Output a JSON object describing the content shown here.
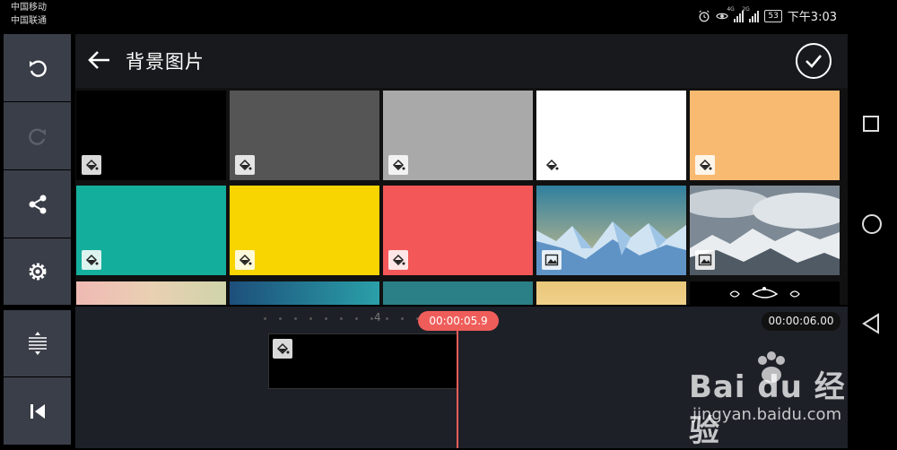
{
  "status_bar": {
    "carrier_1": "中国移动",
    "carrier_2": "中国联通",
    "signal_1_label": "4G",
    "signal_2_label": "2G",
    "battery": "53",
    "time": "下午3:03"
  },
  "toolbar": {
    "items": [
      "undo-icon",
      "redo-icon",
      "share-icon",
      "settings-icon",
      "split-icon",
      "skip-to-start-icon"
    ]
  },
  "header": {
    "title": "背景图片"
  },
  "grid": {
    "tiles": [
      {
        "kind": "color",
        "color": "#000000",
        "icon": "paint-bucket-icon"
      },
      {
        "kind": "color",
        "color": "#555555",
        "icon": "paint-bucket-icon"
      },
      {
        "kind": "color",
        "color": "#a9a9a9",
        "icon": "paint-bucket-icon"
      },
      {
        "kind": "color",
        "color": "#ffffff",
        "icon": "paint-bucket-icon"
      },
      {
        "kind": "color",
        "color": "#f8ba70",
        "icon": "paint-bucket-icon"
      },
      {
        "kind": "color",
        "color": "#14ae9c",
        "icon": "paint-bucket-icon"
      },
      {
        "kind": "color",
        "color": "#f8d400",
        "icon": "paint-bucket-icon"
      },
      {
        "kind": "color",
        "color": "#f35757",
        "icon": "paint-bucket-icon"
      },
      {
        "kind": "image",
        "subject": "low-poly mountains",
        "icon": "image-icon"
      },
      {
        "kind": "image",
        "subject": "snowy mountains under clouds",
        "icon": "image-icon"
      },
      {
        "kind": "image",
        "subject": "pink bokeh"
      },
      {
        "kind": "image",
        "subject": "teal gradient"
      },
      {
        "kind": "image",
        "subject": "dark teal"
      },
      {
        "kind": "image",
        "subject": "sandy yellow"
      },
      {
        "kind": "image",
        "subject": "ornamental black"
      }
    ]
  },
  "timeline": {
    "tick_label": "4",
    "playhead_time": "00:00:05.9",
    "total_duration": "00:00:06.00",
    "accent_color": "#ef5d5a"
  },
  "watermark": {
    "brand": "Bai du 经验",
    "url": "jingyan.baidu.com"
  },
  "nav_bar": {
    "buttons": [
      "recent-apps-icon",
      "home-icon",
      "back-icon"
    ]
  }
}
